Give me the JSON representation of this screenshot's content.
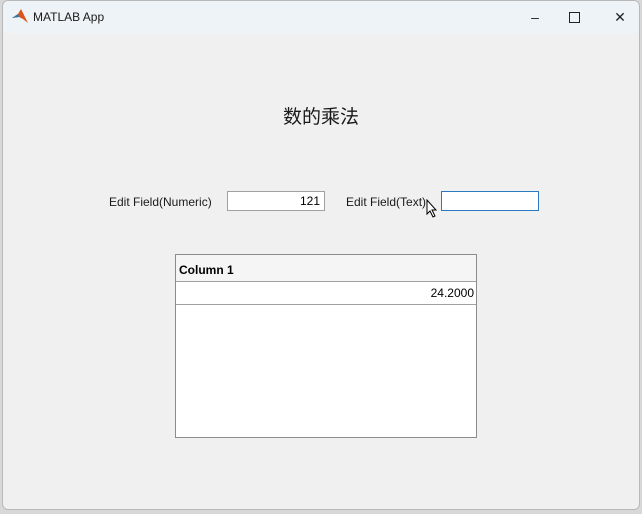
{
  "window": {
    "title": "MATLAB App",
    "minimize_icon": "minimize-icon",
    "maximize_icon": "maximize-icon",
    "close_icon": "close-icon"
  },
  "heading": "数的乘法",
  "numeric_field": {
    "label": "Edit Field(Numeric)",
    "value": "121"
  },
  "text_field": {
    "label": "Edit Field(Text)",
    "value": ""
  },
  "table": {
    "columns": [
      "Column 1"
    ],
    "rows": [
      [
        "24.2000"
      ]
    ]
  }
}
